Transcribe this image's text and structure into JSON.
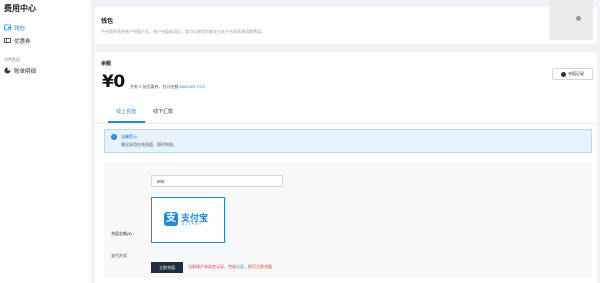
{
  "sidebar": {
    "title": "费用中心",
    "items": [
      {
        "label": "钱包",
        "active": true,
        "icon": "wallet-icon"
      },
      {
        "label": "优惠券",
        "active": false,
        "icon": "coupon-icon"
      }
    ],
    "group_label": "消费数据",
    "group_items": [
      {
        "label": "账单明细",
        "icon": "pie-chart-icon"
      }
    ]
  },
  "wallet": {
    "title": "钱包",
    "description": "平台提供多种账户充值方式，账户充值成功后，您可以使用余额支付本平台的资源消耗费用。"
  },
  "balance": {
    "label": "余额",
    "amount": "¥0",
    "info_prefix": "共有 0 张优惠券，合计金额 ",
    "info_link": "¥554065.7372",
    "record_button": "充值记录"
  },
  "tabs": [
    {
      "label": "线上充值",
      "active": true
    },
    {
      "label": "线下汇款",
      "active": false
    }
  ],
  "tips": {
    "title": "温馨提示",
    "text": "建议采用在线充值，即时到账。"
  },
  "form": {
    "amount_label": "充值金额(¥)",
    "amount_value": "500",
    "pay_label": "支付方式",
    "alipay_cn": "支付宝",
    "alipay_en": "ALIPAY",
    "submit_label": "立即充值",
    "warn_prefix": "当前账户未实名认证，完成",
    "warn_link": "认证",
    "warn_suffix": "，即可立即充值"
  },
  "colors": {
    "accent": "#1e88e5",
    "warning": "#e53935",
    "button_dark": "#1f2d3d"
  }
}
